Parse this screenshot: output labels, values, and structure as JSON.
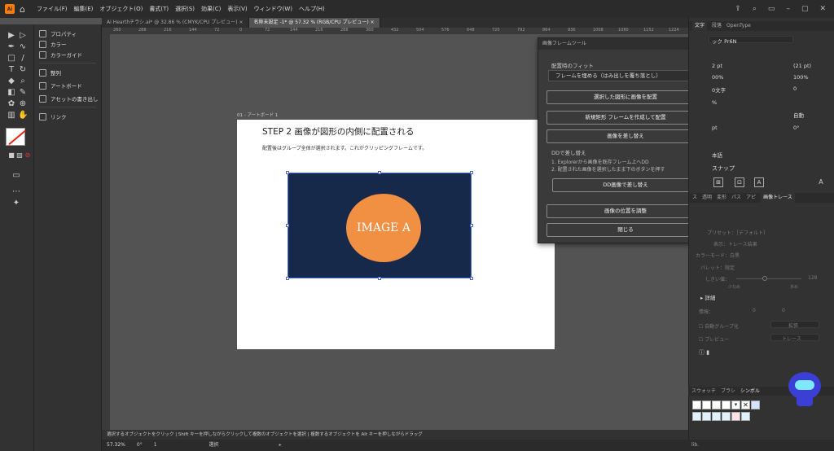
{
  "menubar": {
    "logo": "Ai",
    "menus": [
      "ファイル(F)",
      "編集(E)",
      "オブジェクト(O)",
      "書式(T)",
      "選択(S)",
      "効果(C)",
      "表示(V)",
      "ウィンドウ(W)",
      "ヘルプ(H)"
    ]
  },
  "tabs": [
    {
      "label": "Ai Hearthチラシ.ai* @ 32.86 % (CMYK/CPU プレビュー)  ×",
      "active": false
    },
    {
      "label": "名称未設定 -1* @ 57.32 % (RGB/CPU プレビュー)  ×",
      "active": true
    }
  ],
  "ruler": {
    "ticks": [
      "260",
      "288",
      "216",
      "144",
      "72",
      "0",
      "72",
      "144",
      "216",
      "288",
      "360",
      "432",
      "504",
      "576",
      "648",
      "720",
      "792",
      "864",
      "936",
      "1008",
      "1080",
      "1152",
      "1224"
    ]
  },
  "left_panel": {
    "items": [
      {
        "label": "プロパティ"
      },
      {
        "label": "カラー"
      },
      {
        "label": "カラーガイド"
      },
      {
        "label": "整列"
      },
      {
        "label": "アートボード"
      },
      {
        "label": "アセットの書き出し"
      },
      {
        "label": "リンク"
      }
    ]
  },
  "artboard": {
    "label": "01 - アートボード 1",
    "title": "STEP 2  画像が図形の内側に配置される",
    "description": "配置後はグループ全体が選択されます。これがクリッピングフレームです。",
    "image_text": "IMAGE A",
    "frame_color": "#17294a",
    "circle_color": "#f18f43"
  },
  "dialog": {
    "title": "画像フレームツール",
    "fit_label": "配置時のフィット",
    "fit_value": "フレームを埋める（はみ出しを覆ち落とし）",
    "btn_place": "選択した図形に画像を配置",
    "btn_new_rect": "新規矩形 フレームを作成して配置",
    "btn_replace": "画像を差し替え",
    "dd_label": "DDで差し替え",
    "dd_note1": "1. Explorerから画像を既存フレーム上へDD",
    "dd_note2": "2. 配置された画像を選択したまま下のボタンを押す",
    "btn_dd_replace": "DD画像で差し替え",
    "btn_adjust": "画像の位置を調整",
    "btn_close": "閉じる"
  },
  "right_panel": {
    "tabs": [
      "文字",
      "段落",
      "OpenType"
    ],
    "font": "ック Pr6N",
    "size": "2 pt",
    "leading": "(21 pt)",
    "hscale": "00%",
    "vscale": "100%",
    "tracking_label": "0文字",
    "tracking_val": "0",
    "pct": "%",
    "auto": "自動",
    "baseline": "pt",
    "rotate": "0°",
    "lang": "本語",
    "snap": "スナップ",
    "trace_tabs": [
      "ス",
      "透明",
      "変形",
      "パス",
      "アピ",
      "画像トレース"
    ],
    "trace_preset": "プリセット：［デフォルト］",
    "trace_view": "表示：トレース結果",
    "trace_mode": "カラーモード：白黒",
    "trace_palette": "パレット：限定",
    "trace_threshold": "しきい値：",
    "trace_threshold_val": "128",
    "trace_low": "少なめ",
    "trace_high": "多め",
    "trace_detail": "詳細",
    "trace_stat1": "情報：",
    "trace_stat2": "0",
    "trace_stat3": "0",
    "trace_group": "自動グループ化",
    "trace_expand": "拡張",
    "trace_preview": "プレビュー",
    "trace_btn": "トレース",
    "swatch_tabs": [
      "スウォッチ",
      "ブラシ",
      "シンボル"
    ]
  },
  "status": {
    "hint": "選択するオブジェクトをクリック  |  Shift キーを押しながらクリックして複数のオブジェクトを選択  |  複数するオブジェクトを Alt キーを押しながらドラッグ",
    "zoom": "57.32%",
    "rotate": "0°",
    "page": "1",
    "mode": "選択"
  }
}
